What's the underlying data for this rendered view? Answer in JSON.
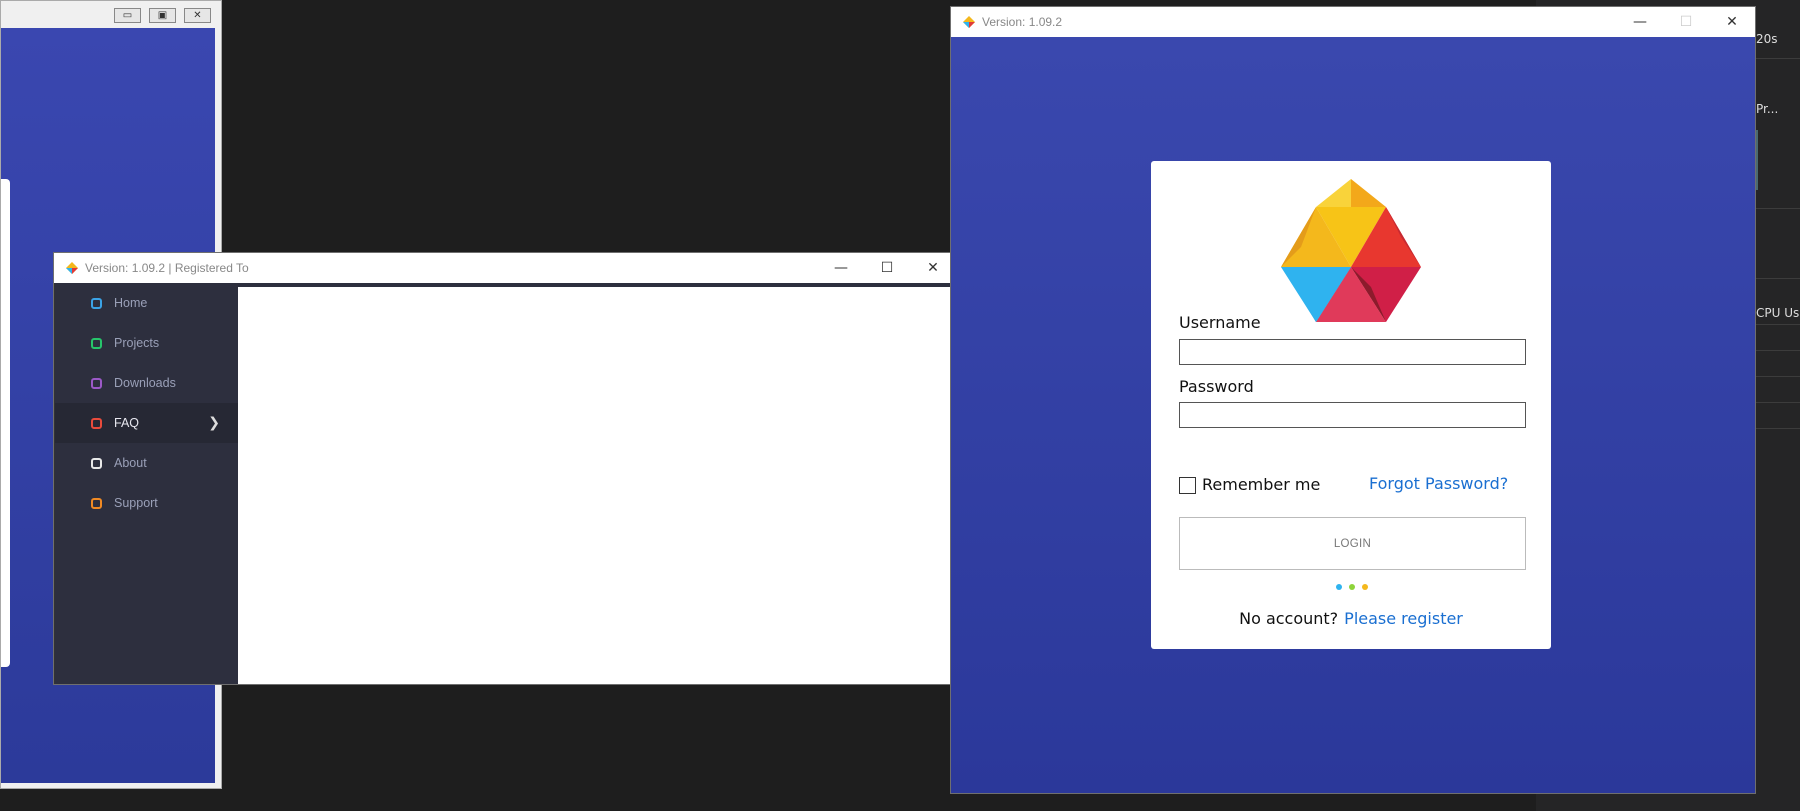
{
  "background_window": {
    "buttons": [
      "▭",
      "▣",
      "✕"
    ]
  },
  "tool_window": {
    "label_top": "20s",
    "label_mid": "Pr...",
    "label_cpu": "CPU Usag"
  },
  "main_window": {
    "title": "Version: 1.09.2 | Registered To",
    "nav": [
      {
        "label": "Home",
        "color": "#3ba3e6"
      },
      {
        "label": "Projects",
        "color": "#27c46b"
      },
      {
        "label": "Downloads",
        "color": "#9b59c7"
      },
      {
        "label": "FAQ",
        "color": "#e84b3c",
        "active": true
      },
      {
        "label": "About",
        "color": "#e8e8e8"
      },
      {
        "label": "Support",
        "color": "#f08a24"
      }
    ]
  },
  "login_window": {
    "title": "Version: 1.09.2",
    "username_label": "Username",
    "username_value": "",
    "password_label": "Password",
    "password_value": "",
    "remember_label": "Remember me",
    "remember_checked": false,
    "forgot_label": "Forgot Password?",
    "login_label": "LOGIN",
    "no_account_label": "No account?",
    "register_label": "Please register",
    "loader_colors": [
      "#2fb3ef",
      "#8ed43a",
      "#f4b81c"
    ]
  },
  "colors": {
    "accent_blue": "#3a48ae",
    "link": "#1a6fd1",
    "sidebar": "#2d2f3e"
  }
}
